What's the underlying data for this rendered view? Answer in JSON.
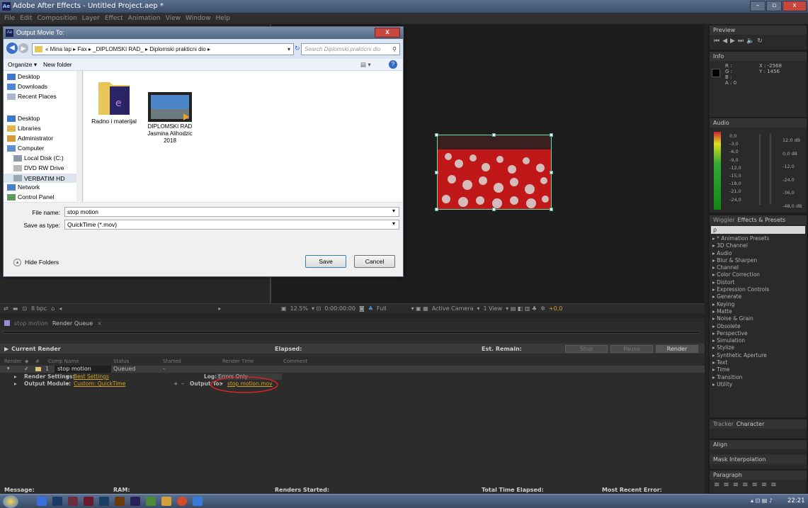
{
  "app": {
    "title": "Adobe After Effects - Untitled Project.aep *",
    "logo_text": "Ae",
    "menu": [
      "File",
      "Edit",
      "Composition",
      "Layer",
      "Effect",
      "Animation",
      "View",
      "Window",
      "Help"
    ],
    "window_controls": {
      "minimize": "–",
      "maximize": "▫",
      "close": "x"
    }
  },
  "dialog": {
    "title": "Output Movie To:",
    "close_label": "x",
    "breadcrumb": "« Mina lap ▸ Fax ▸ _DIPLOMSKI RAD_ ▸ Diplomski prakticni dio ▸",
    "search_placeholder": "Search Diplomski prakticni dio",
    "organize_label": "Organize ▾",
    "new_folder_label": "New folder",
    "nav": {
      "favorites": [
        "Desktop",
        "Downloads",
        "Recent Places"
      ],
      "desktop": "Desktop",
      "libraries": "Libraries",
      "administrator": "Administrator",
      "computer": "Computer",
      "drives": [
        "Local Disk (C:)",
        "DVD RW Drive",
        "VERBATIM HD"
      ],
      "network": "Network",
      "control_panel": "Control Panel"
    },
    "files": [
      {
        "name": "Radno i materijal",
        "type": "folder"
      },
      {
        "name": "DIPLOMSKI RAD Jasmina Alihodzic 2018",
        "type": "video"
      }
    ],
    "file_name_label": "File name:",
    "file_name_value": "stop motion",
    "save_type_label": "Save as type:",
    "save_type_value": "QuickTime (*.mov)",
    "hide_folders_label": "Hide Folders",
    "save_label": "Save",
    "cancel_label": "Cancel"
  },
  "composition": {
    "footer": {
      "zoom": "12.5%",
      "timecode": "0:00:00:00",
      "resolution": "Full",
      "camera": "Active Camera",
      "views": "1 View",
      "exposure": "+0,0"
    }
  },
  "project": {
    "bpc": "8 bpc"
  },
  "render_queue": {
    "tabs": [
      "stop motion",
      "Render Queue"
    ],
    "current_render_label": "Current Render",
    "elapsed_label": "Elapsed:",
    "est_remain_label": "Est. Remain:",
    "stop_label": "Stop",
    "pause_label": "Pause",
    "render_label": "Render",
    "columns": [
      "Render",
      "#",
      "Comp Name",
      "Status",
      "Started",
      "Render Time",
      "Comment"
    ],
    "item": {
      "index": "1",
      "comp_name": "stop motion",
      "status": "Queued",
      "started": "-",
      "render_settings_label": "Render Settings:",
      "render_settings_value": "Best Settings",
      "log_label": "Log:",
      "log_value": "Errors Only",
      "output_module_label": "Output Module:",
      "output_module_value": "Custom: QuickTime",
      "output_to_label": "Output To:",
      "output_to_value": "stop motion.mov"
    },
    "status_bar": {
      "message": "Message:",
      "ram": "RAM:",
      "renders_started": "Renders Started:",
      "total_elapsed": "Total Time Elapsed:",
      "recent_error": "Most Recent Error:"
    }
  },
  "right_panels": {
    "preview_tab": "Preview",
    "info_tab": "Info",
    "info": {
      "r": "R :",
      "g": "G :",
      "b": "B :",
      "a": "A : 0",
      "x": "X : -2568",
      "y": "Y : 1456"
    },
    "audio_tab": "Audio",
    "audio_left": [
      "0,0",
      "-3,0",
      "-6,0",
      "-9,0",
      "-12,0",
      "-15,0",
      "-18,0",
      "-21,0",
      "-24,0"
    ],
    "audio_right": [
      "12,0 dB",
      "0,0 dB",
      "-12,0",
      "-24,0",
      "-36,0",
      "-48,0 dB"
    ],
    "wiggler_tab": "Wiggler",
    "effects_tab": "Effects & Presets",
    "effects_search": "ρ",
    "effects": [
      "* Animation Presets",
      "3D Channel",
      "Audio",
      "Blur & Sharpen",
      "Channel",
      "Color Correction",
      "Distort",
      "Expression Controls",
      "Generate",
      "Keying",
      "Matte",
      "Noise & Grain",
      "Obsolete",
      "Perspective",
      "Simulation",
      "Stylize",
      "Synthetic Aperture",
      "Text",
      "Time",
      "Transition",
      "Utility"
    ],
    "tracker_tab": "Tracker",
    "character_tab": "Character",
    "align_tab": "Align",
    "mask_tab": "Mask Interpolation",
    "paragraph_tab": "Paragraph"
  },
  "taskbar": {
    "clock": "22:21"
  },
  "colors": {
    "accent_orange": "#d4a020",
    "annotation_red": "#d92323",
    "ae_panel": "#2c2c2c"
  }
}
